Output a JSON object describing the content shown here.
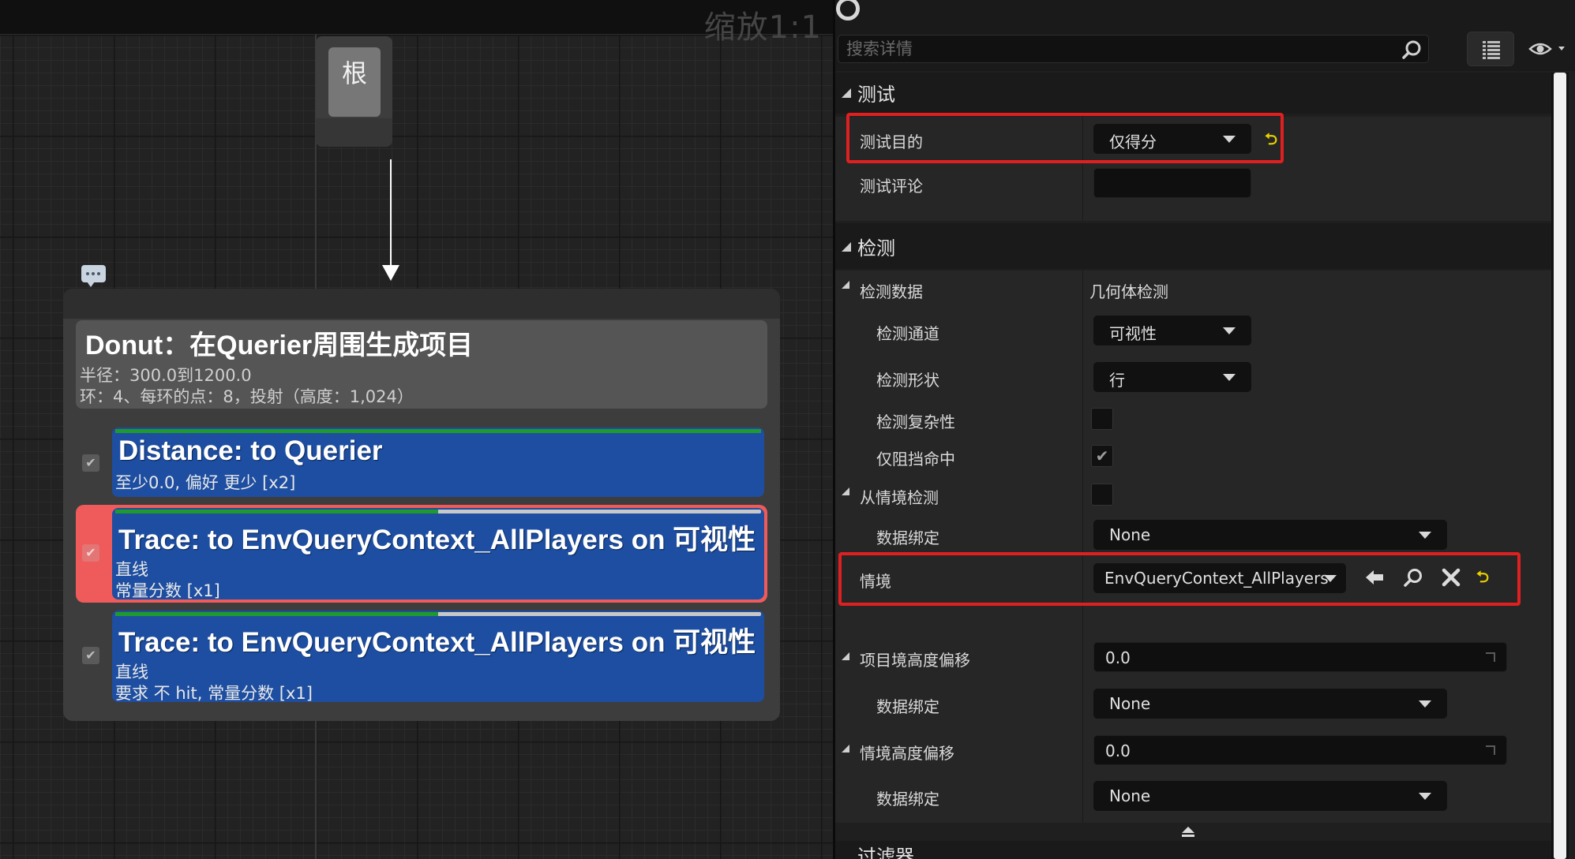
{
  "graph": {
    "zoom_label": "缩放1:1",
    "root_label": "根",
    "generator": {
      "title": "Donut：在Querier周围生成项目",
      "line1": "半径：300.0到1200.0",
      "line2": "环：4、每环的点：8，投射（高度：1,024）"
    },
    "tests": [
      {
        "title": "Distance: to Querier",
        "sub1": "至少0.0, 偏好 更少 [x2]",
        "sub2": "",
        "checked": true,
        "selected": false,
        "weight_fill": 1.0
      },
      {
        "title": "Trace: to EnvQueryContext_AllPlayers on 可视性",
        "sub1": "直线",
        "sub2": "常量分数 [x1]",
        "checked": true,
        "selected": true,
        "weight_fill": 0.5
      },
      {
        "title": "Trace: to EnvQueryContext_AllPlayers on 可视性",
        "sub1": "直线",
        "sub2": "要求 不 hit, 常量分数 [x1]",
        "checked": true,
        "selected": false,
        "weight_fill": 0.5
      }
    ]
  },
  "details": {
    "search_placeholder": "搜索详情",
    "sections": {
      "test": {
        "title": "测试",
        "purpose_label": "测试目的",
        "purpose_value": "仅得分",
        "comment_label": "测试评论",
        "comment_value": ""
      },
      "trace": {
        "title": "检测",
        "trace_data_label": "检测数据",
        "trace_data_value": "几何体检测",
        "channel_label": "检测通道",
        "channel_value": "可视性",
        "shape_label": "检测形状",
        "shape_value": "行",
        "complex_label": "检测复杂性",
        "complex_checked": false,
        "block_label": "仅阻挡命中",
        "block_checked": true,
        "from_context_label": "从情境检测",
        "from_context_checked": false,
        "binding1_label": "数据绑定",
        "binding1_value": "None",
        "context_label": "情境",
        "context_value": "EnvQueryContext_AllPlayers",
        "item_height_label": "项目境高度偏移",
        "item_height_value": "0.0",
        "binding2_label": "数据绑定",
        "binding2_value": "None",
        "context_height_label": "情境高度偏移",
        "context_height_value": "0.0",
        "binding3_label": "数据绑定",
        "binding3_value": "None"
      },
      "filter": {
        "title": "过滤器"
      }
    }
  },
  "colors": {
    "test_node_blue": "#1d4ea1",
    "selected_red": "#ef5a5a",
    "highlight_red": "#e02020",
    "reset_yellow": "#e8d000",
    "weight_green": "#1f9a2d"
  },
  "icons": [
    "ring-icon",
    "search-icon",
    "grid-view-icon",
    "eye-icon",
    "reset-icon",
    "arrow-left-icon",
    "magnifier-icon",
    "clear-icon",
    "comment-icon",
    "checkmark-icon",
    "collapse-arrow-icon"
  ]
}
